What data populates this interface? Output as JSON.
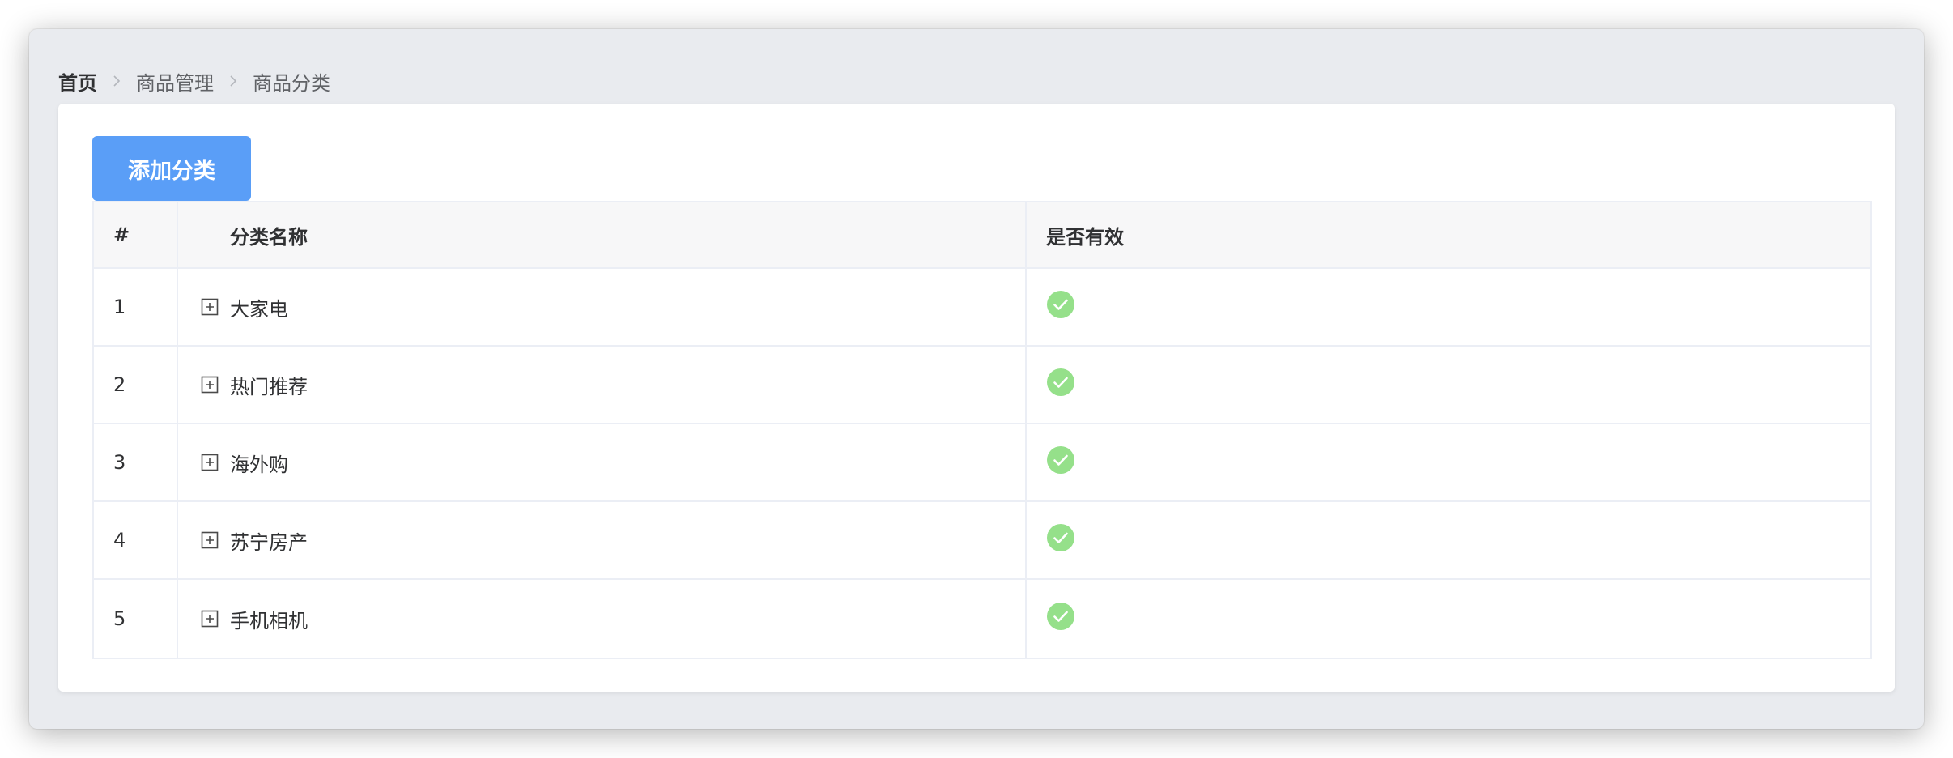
{
  "breadcrumb": {
    "home": "首页",
    "level1": "商品管理",
    "level2": "商品分类"
  },
  "toolbar": {
    "add_label": "添加分类"
  },
  "table": {
    "columns": [
      "#",
      "分类名称",
      "是否有效"
    ],
    "rows": [
      {
        "index": "1",
        "name": "大家电",
        "valid": true
      },
      {
        "index": "2",
        "name": "热门推荐",
        "valid": true
      },
      {
        "index": "3",
        "name": "海外购",
        "valid": true
      },
      {
        "index": "4",
        "name": "苏宁房产",
        "valid": true
      },
      {
        "index": "5",
        "name": "手机相机",
        "valid": true
      }
    ]
  },
  "icons": {
    "separator": "chevron-right-icon",
    "expand": "plus-square-icon",
    "valid": "check-circle-icon"
  },
  "colors": {
    "primary_button": "#5a9ef7",
    "valid_check": "#95e08a",
    "page_background": "#e9ebef"
  }
}
